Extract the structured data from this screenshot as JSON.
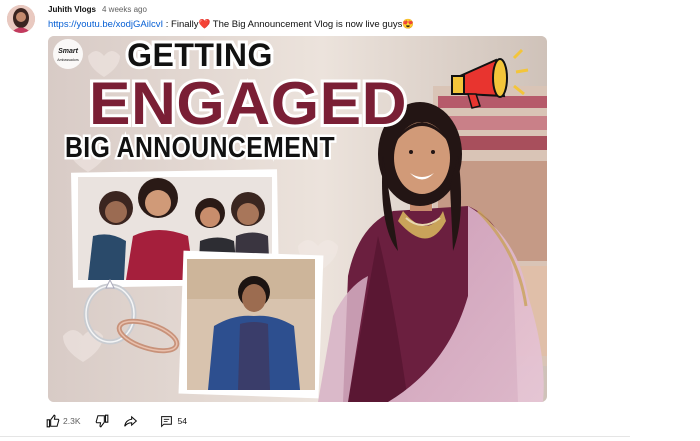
{
  "post": {
    "author": "Juhith Vlogs",
    "time": "4 weeks ago",
    "link": "https://youtu.be/xodjGAilcvI",
    "text": " : Finally❤️ The Big Announcement Vlog is now live guys😍"
  },
  "thumbnail": {
    "badge_line1": "Smart",
    "badge_line2": "Ambassadors",
    "title_line1": "GETTING",
    "title_line2": "ENGAGED",
    "title_line3": "BIG ANNOUNCEMENT",
    "megaphone_icon": "megaphone-icon",
    "ring_icon": "ring-icon"
  },
  "actions": {
    "likes": "2.3K",
    "comments": "54",
    "like_icon": "thumbs-up-icon",
    "dislike_icon": "thumbs-down-icon",
    "share_icon": "share-icon",
    "comment_icon": "comment-icon"
  },
  "colors": {
    "title_maroon": "#7a1f35",
    "link_blue": "#065fd4",
    "dress_purple": "#6b1f3f"
  }
}
